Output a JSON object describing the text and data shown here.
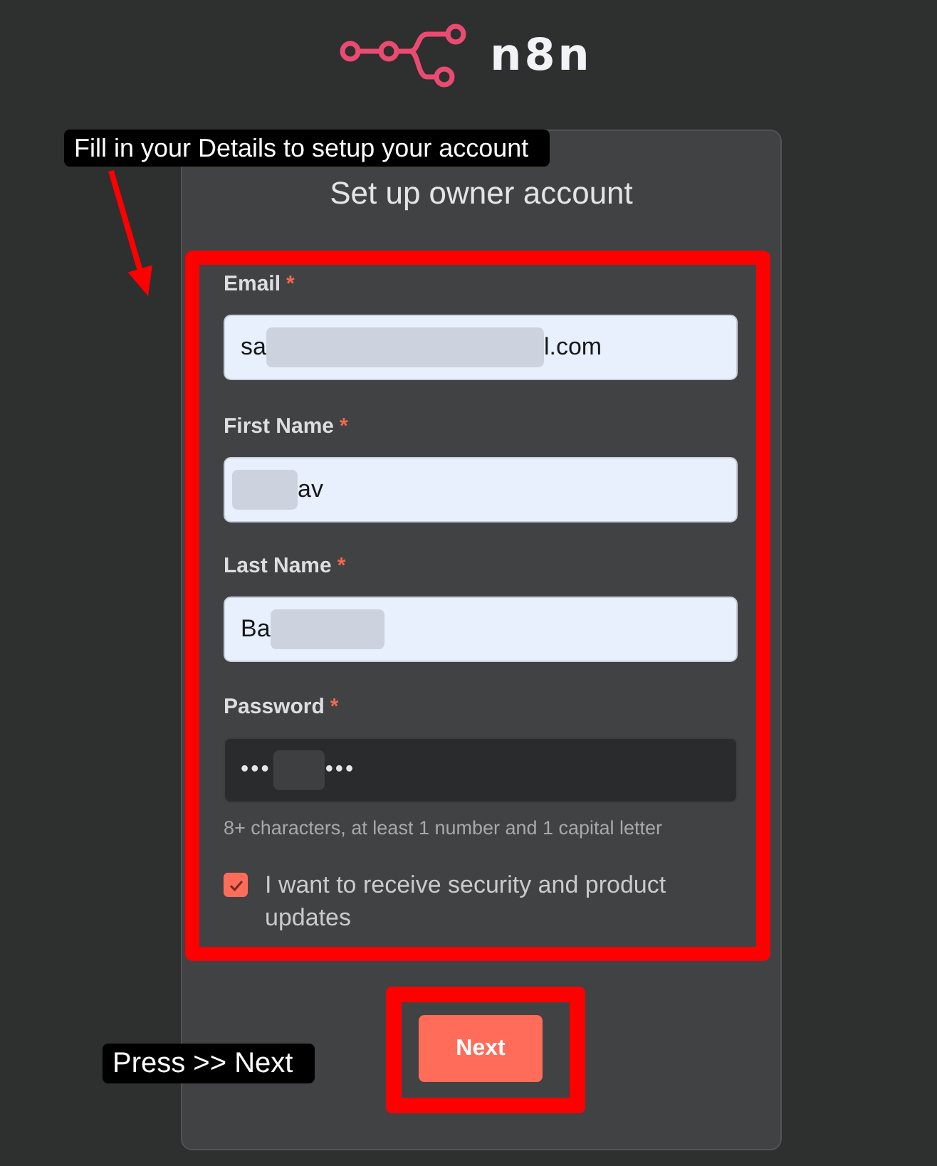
{
  "logo": {
    "name": "n8n"
  },
  "annotations": [
    {
      "text": "Fill in your Details to setup your account",
      "arrow": true
    },
    {
      "text": "Press >> Next",
      "arrow": false
    }
  ],
  "card": {
    "title": "Set up owner account",
    "form_highlighted": true
  },
  "fields": [
    {
      "kind": "text",
      "label": "Email",
      "required_mark": "*",
      "autofilled": true,
      "value": [
        {
          "kind": "text",
          "text": "sa"
        },
        {
          "kind": "redacted"
        },
        {
          "kind": "text",
          "text": "l.com"
        }
      ]
    },
    {
      "kind": "text",
      "label": "First Name",
      "required_mark": "*",
      "autofilled": true,
      "value": [
        {
          "kind": "redacted"
        },
        {
          "kind": "text",
          "text": "av"
        }
      ]
    },
    {
      "kind": "text",
      "label": "Last Name",
      "required_mark": "*",
      "autofilled": true,
      "value": [
        {
          "kind": "text",
          "text": "Ba"
        },
        {
          "kind": "redacted"
        }
      ]
    },
    {
      "kind": "password",
      "label": "Password",
      "required_mark": "*",
      "autofilled": false,
      "value": [
        {
          "kind": "text",
          "text": "•••"
        },
        {
          "kind": "redacted"
        },
        {
          "kind": "text",
          "text": "•••"
        }
      ],
      "hint": "8+ characters, at least 1 number and 1 capital letter"
    }
  ],
  "updates_checkbox": {
    "label": "I want to receive security and product updates",
    "checked": true
  },
  "next_button": {
    "label": "Next",
    "highlighted": true
  }
}
